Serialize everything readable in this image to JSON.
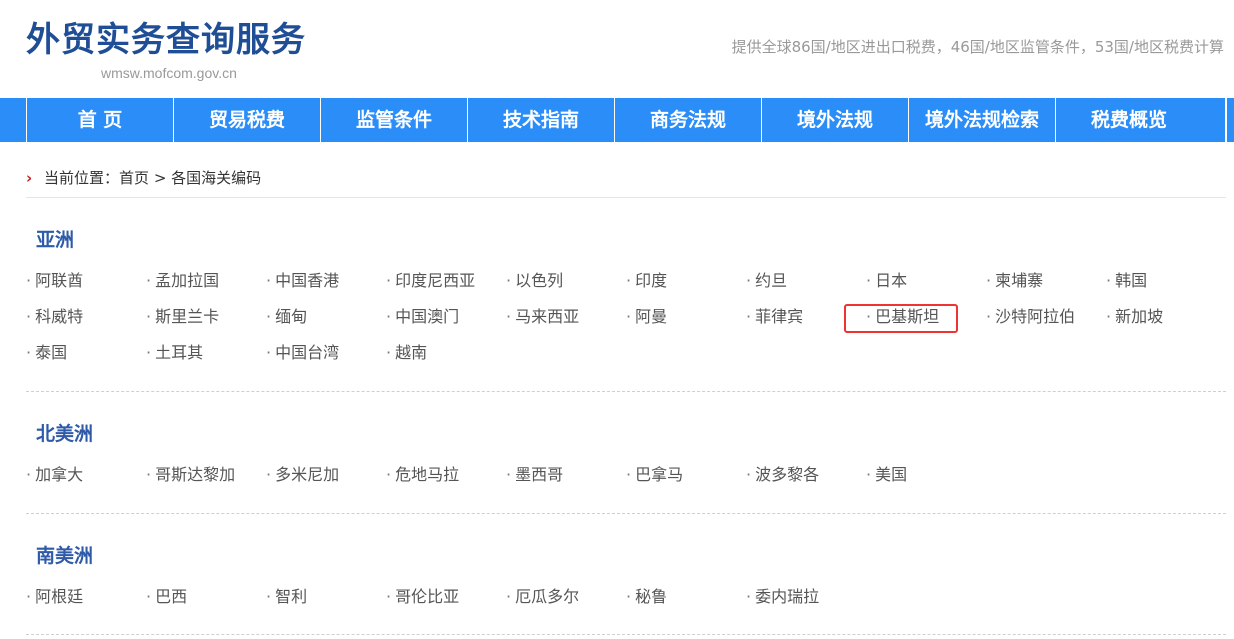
{
  "header": {
    "title": "外贸实务查询服务",
    "domain": "wmsw.mofcom.gov.cn",
    "description": "提供全球86国/地区进出口税费，46国/地区监管条件，53国/地区税费计算"
  },
  "nav": [
    {
      "label": "首 页"
    },
    {
      "label": "贸易税费"
    },
    {
      "label": "监管条件"
    },
    {
      "label": "技术指南"
    },
    {
      "label": "商务法规"
    },
    {
      "label": "境外法规"
    },
    {
      "label": "境外法规检索"
    },
    {
      "label": "税费概览"
    }
  ],
  "breadcrumb": {
    "prefix": "当前位置：",
    "home": "首页",
    "separator": ">",
    "current": "各国海关编码"
  },
  "regions": [
    {
      "name": "亚洲",
      "countries": [
        "阿联酋",
        "孟加拉国",
        "中国香港",
        "印度尼西亚",
        "以色列",
        "印度",
        "约旦",
        "日本",
        "柬埔寨",
        "韩国",
        "科威特",
        "斯里兰卡",
        "缅甸",
        "中国澳门",
        "马来西亚",
        "阿曼",
        "菲律宾",
        "巴基斯坦",
        "沙特阿拉伯",
        "新加坡",
        "泰国",
        "土耳其",
        "中国台湾",
        "越南"
      ]
    },
    {
      "name": "北美洲",
      "countries": [
        "加拿大",
        "哥斯达黎加",
        "多米尼加",
        "危地马拉",
        "墨西哥",
        "巴拿马",
        "波多黎各",
        "美国"
      ]
    },
    {
      "name": "南美洲",
      "countries": [
        "阿根廷",
        "巴西",
        "智利",
        "哥伦比亚",
        "厄瓜多尔",
        "秘鲁",
        "委内瑞拉"
      ]
    }
  ],
  "colors": {
    "nav_bg": "#2b8df8",
    "title": "#1f4e96",
    "region_title": "#2e5aa8",
    "highlight": "#ee3333"
  }
}
